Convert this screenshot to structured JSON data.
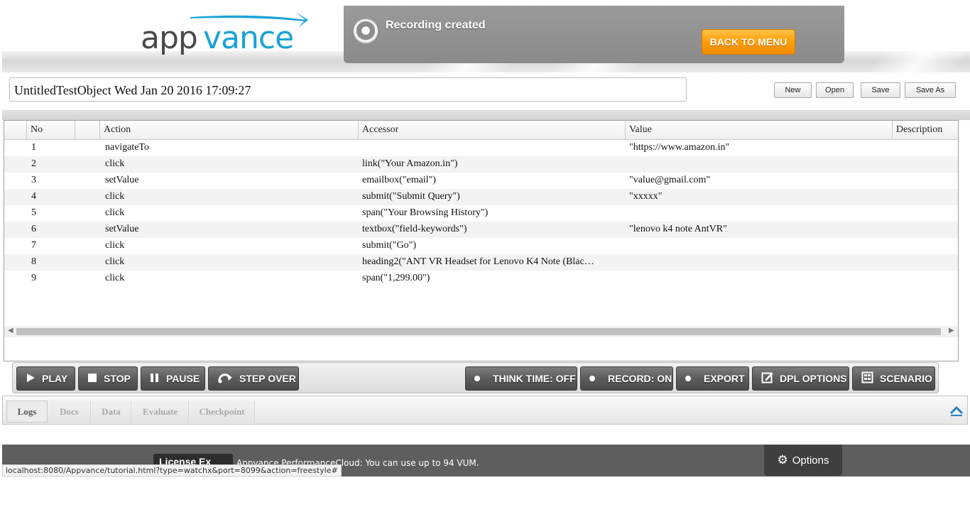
{
  "header": {
    "logo_text": "appvance",
    "recording_status": "Recording created",
    "back_to_menu_label": "BACK TO MENU"
  },
  "test_object": {
    "name": "UntitledTestObject Wed Jan 20 2016 17:09:27"
  },
  "file_buttons": {
    "new": "New",
    "open": "Open",
    "save": "Save",
    "save_as": "Save As"
  },
  "grid": {
    "columns": {
      "no": "No",
      "action": "Action",
      "accessor": "Accessor",
      "value": "Value",
      "description": "Description"
    },
    "rows": [
      {
        "no": "1",
        "action": "navigateTo",
        "accessor": "",
        "value": "\"https://www.amazon.in\""
      },
      {
        "no": "2",
        "action": "click",
        "accessor": "link(\"Your Amazon.in\")",
        "value": ""
      },
      {
        "no": "3",
        "action": "setValue",
        "accessor": "emailbox(\"email\")",
        "value": "\"value@gmail.com\""
      },
      {
        "no": "4",
        "action": "click",
        "accessor": "submit(\"Submit Query\")",
        "value": "\"xxxxx\""
      },
      {
        "no": "5",
        "action": "click",
        "accessor": "span(\"Your Browsing History\")",
        "value": ""
      },
      {
        "no": "6",
        "action": "setValue",
        "accessor": "textbox(\"field-keywords\")",
        "value": "\"lenovo k4 note AntVR\""
      },
      {
        "no": "7",
        "action": "click",
        "accessor": "submit(\"Go\")",
        "value": ""
      },
      {
        "no": "8",
        "action": "click",
        "accessor": "heading2(\"ANT VR Headset for Lenovo K4 Note (Blac…",
        "value": ""
      },
      {
        "no": "9",
        "action": "click",
        "accessor": "span(\"1,299.00\")",
        "value": ""
      }
    ]
  },
  "toolbar": {
    "play": "PLAY",
    "stop": "STOP",
    "pause": "PAUSE",
    "step_over": "STEP OVER",
    "think_time": "THINK TIME: OFF",
    "record": "RECORD: ON",
    "export": "EXPORT",
    "dpl_options": "DPL OPTIONS",
    "scenario": "SCENARIO"
  },
  "tabs": [
    "Logs",
    "Docs",
    "Data",
    "Evaluate",
    "Checkpoint"
  ],
  "active_tab": "Logs",
  "footer": {
    "license_button": "License Ex",
    "message": "Appvance PerformanceCloud: You can use up to 94 VUM.",
    "options": "Options"
  },
  "status_bar": {
    "url": "localhost:8080/Appvance/tutorial.html?type=watchx&port=8099&action=freestyle#"
  },
  "colors": {
    "accent_orange": "#ff9d00",
    "logo_blue": "#1aa3d8",
    "logo_gray": "#4a4a4a",
    "toolbar_button": "#5c5c5c",
    "footer_bg": "#5e5e5e"
  }
}
